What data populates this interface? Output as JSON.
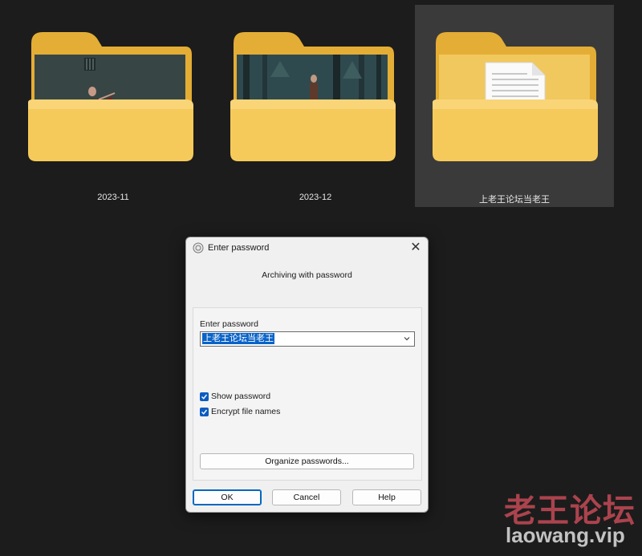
{
  "folders": [
    {
      "label": "2023-11",
      "icon": "folder-photo-icon"
    },
    {
      "label": "2023-12",
      "icon": "folder-photo-icon"
    },
    {
      "label": "上老王论坛当老王",
      "icon": "folder-document-icon",
      "selected": true
    }
  ],
  "dialog": {
    "title": "Enter password",
    "subtitle": "Archiving with password",
    "field_label": "Enter password",
    "password_value": "上老王论坛当老王",
    "show_password_label": "Show password",
    "show_password_checked": true,
    "encrypt_names_label": "Encrypt file names",
    "encrypt_names_checked": true,
    "organize_label": "Organize passwords...",
    "ok_label": "OK",
    "cancel_label": "Cancel",
    "help_label": "Help"
  },
  "watermark": {
    "cn": "老王论坛",
    "url": "laowang.vip"
  },
  "colors": {
    "background": "#1c1c1c",
    "folder_back": "#e8b73f",
    "folder_front": "#f6ca5a",
    "selection": "#0a63c9",
    "watermark_red": "#c44a56"
  }
}
